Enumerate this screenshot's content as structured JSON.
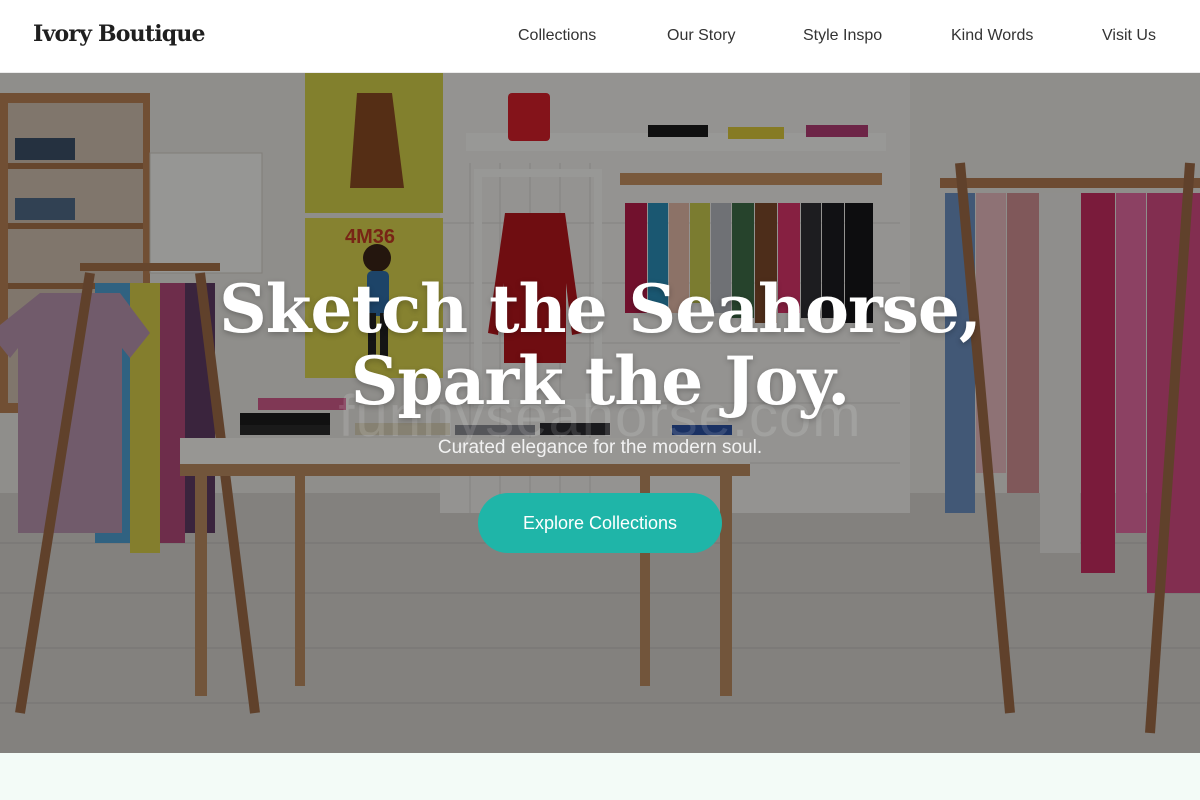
{
  "header": {
    "brand": "Ivory Boutique",
    "nav": [
      {
        "label": "Collections"
      },
      {
        "label": "Our Story"
      },
      {
        "label": "Style Inspo"
      },
      {
        "label": "Kind Words"
      },
      {
        "label": "Visit Us"
      }
    ]
  },
  "hero": {
    "title_line1": "Sketch the Seahorse,",
    "title_line2": "Spark the Joy.",
    "subtitle": "Curated elegance for the modern soul.",
    "cta_label": "Explore Collections",
    "watermark": "funnyseahorse.com",
    "image": {
      "alt": "Boutique interior with clothing racks, shelves and a display table",
      "store_sign": "4M36"
    }
  },
  "theme": {
    "accent": "#1fb5a8",
    "nav_text": "#333333",
    "footer_band": "#f3fbf7"
  }
}
